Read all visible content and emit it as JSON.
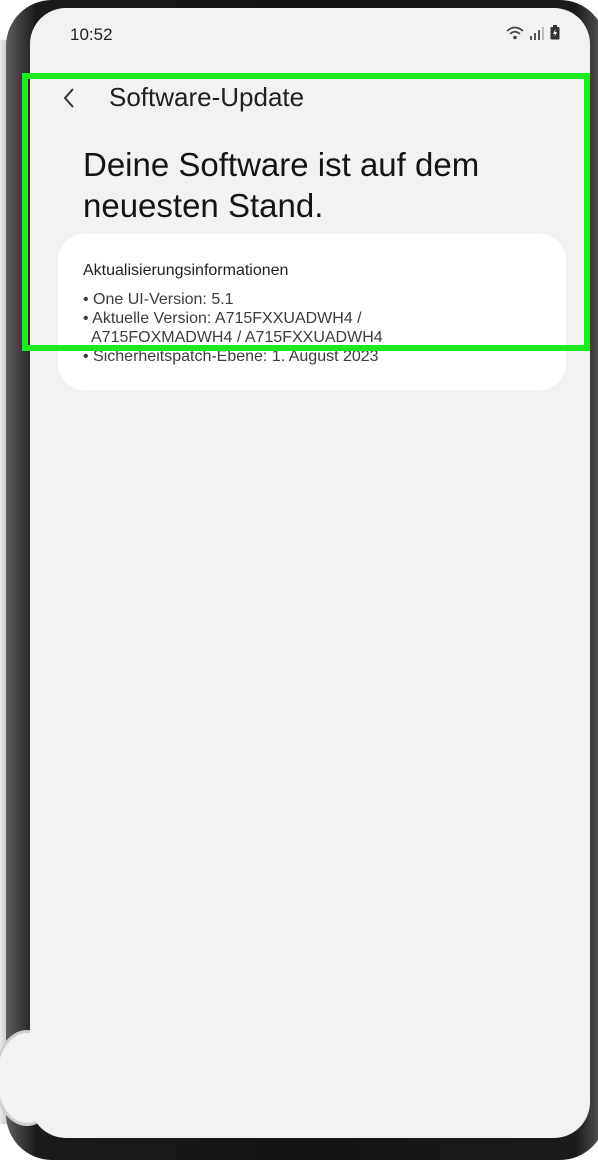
{
  "status_bar": {
    "time": "10:52",
    "icons": [
      "wifi-icon",
      "signal-icon",
      "battery-icon"
    ]
  },
  "app_bar": {
    "back_icon": "back-arrow-icon",
    "title": "Software-Update"
  },
  "headline": "Deine Software ist auf dem neuesten Stand.",
  "info_card": {
    "title": "Aktualisierungsinformationen",
    "items": [
      "• One UI-Version: 5.1",
      "• Aktuelle Version: A715FXXUADWH4 /",
      "  A715FOXMADWH4 / A715FXXUADWH4",
      "• Sicherheitspatch-Ebene: 1. August 2023"
    ]
  },
  "colors": {
    "highlight": "#1ee81e",
    "screen_bg": "#f2f2f2",
    "card_bg": "#ffffff"
  }
}
